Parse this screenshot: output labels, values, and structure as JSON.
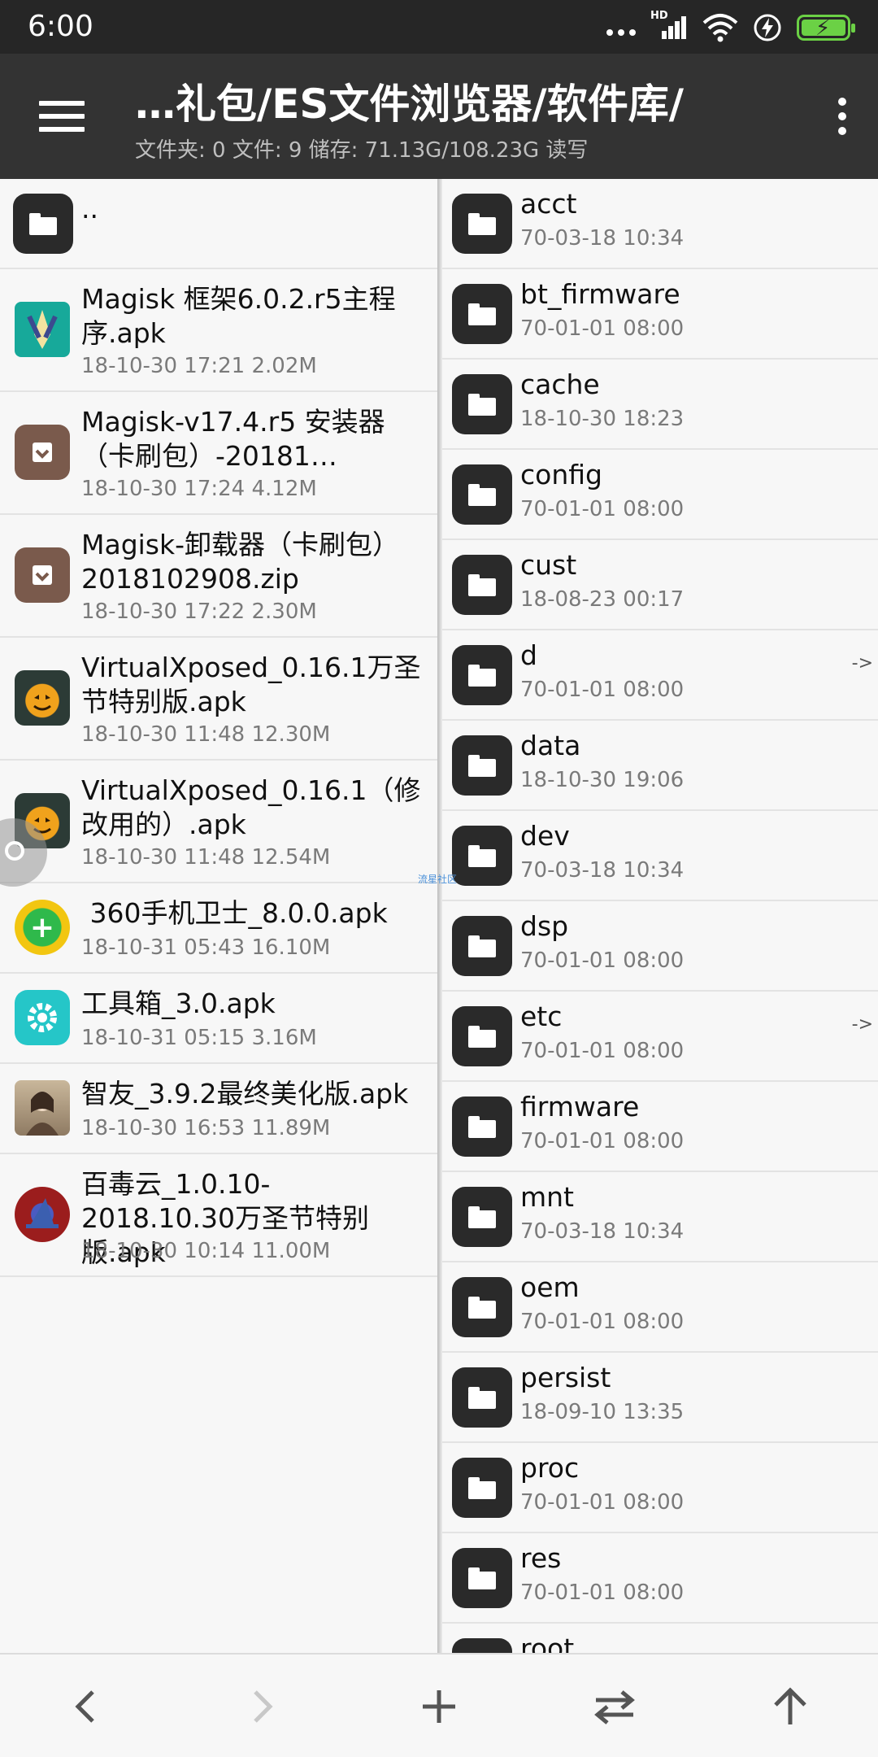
{
  "status_bar": {
    "time": "6:00",
    "icons": [
      "more-dots-icon",
      "hd-signal-icon",
      "wifi-icon",
      "flash-icon",
      "battery-charging-icon"
    ],
    "hd_label": "HD"
  },
  "toolbar": {
    "title": "…礼包/ES文件浏览器/软件库/",
    "subtitle": "文件夹: 0  文件: 9  储存: 71.13G/108.23G  读写"
  },
  "left_pane": {
    "parent_label": "..",
    "items": [
      {
        "name": "Magisk 框架6.0.2.r5主程序.apk",
        "meta": "18-10-30 17:21  2.02M",
        "icon": "magisk-icon"
      },
      {
        "name": "Magisk-v17.4.r5 安装器（卡刷包）-20181…",
        "meta": "18-10-30 17:24  4.12M",
        "icon": "archive-icon"
      },
      {
        "name": "Magisk-卸载器（卡刷包）2018102908.zip",
        "meta": "18-10-30 17:22  2.30M",
        "icon": "archive-icon"
      },
      {
        "name": "VirtualXposed_0.16.1万圣节特别版.apk",
        "meta": "18-10-30 11:48  12.30M",
        "icon": "pumpkin-icon"
      },
      {
        "name": "VirtualXposed_0.16.1（修改用的）.apk",
        "meta": "18-10-30 11:48  12.54M",
        "icon": "pumpkin-icon"
      },
      {
        "name": " 360手机卫士_8.0.0.apk",
        "meta": "18-10-31 05:43  16.10M",
        "icon": "360-security-icon"
      },
      {
        "name": "工具箱_3.0.apk",
        "meta": "18-10-31 05:15  3.16M",
        "icon": "toolbox-gear-icon"
      },
      {
        "name": "智友_3.9.2最终美化版.apk",
        "meta": "18-10-30 16:53  11.89M",
        "icon": "avatar-icon"
      },
      {
        "name": "百毒云_1.0.10-2018.10.30万圣节特别版.apk",
        "meta": "18-10-30 10:14  11.00M",
        "icon": "witch-hat-icon"
      }
    ]
  },
  "right_pane": {
    "items": [
      {
        "name": "acct",
        "meta": "70-03-18 10:34",
        "link": ""
      },
      {
        "name": "bt_firmware",
        "meta": "70-01-01 08:00",
        "link": ""
      },
      {
        "name": "cache",
        "meta": "18-10-30 18:23",
        "link": ""
      },
      {
        "name": "config",
        "meta": "70-01-01 08:00",
        "link": ""
      },
      {
        "name": "cust",
        "meta": "18-08-23 00:17",
        "link": ""
      },
      {
        "name": "d",
        "meta": "70-01-01 08:00",
        "link": "->"
      },
      {
        "name": "data",
        "meta": "18-10-30 19:06",
        "link": ""
      },
      {
        "name": "dev",
        "meta": "70-03-18 10:34",
        "link": ""
      },
      {
        "name": "dsp",
        "meta": "70-01-01 08:00",
        "link": ""
      },
      {
        "name": "etc",
        "meta": "70-01-01 08:00",
        "link": "->"
      },
      {
        "name": "firmware",
        "meta": "70-01-01 08:00",
        "link": ""
      },
      {
        "name": "mnt",
        "meta": "70-03-18 10:34",
        "link": ""
      },
      {
        "name": "oem",
        "meta": "70-01-01 08:00",
        "link": ""
      },
      {
        "name": "persist",
        "meta": "18-09-10 13:35",
        "link": ""
      },
      {
        "name": "proc",
        "meta": "70-01-01 08:00",
        "link": ""
      },
      {
        "name": "res",
        "meta": "70-01-01 08:00",
        "link": ""
      },
      {
        "name": "root",
        "meta": "",
        "link": ""
      }
    ]
  },
  "watermark": "流星社区",
  "bottom_bar": {
    "back": "‹",
    "forward": "›",
    "add": "+",
    "swap": "⇄",
    "up": "↑"
  }
}
